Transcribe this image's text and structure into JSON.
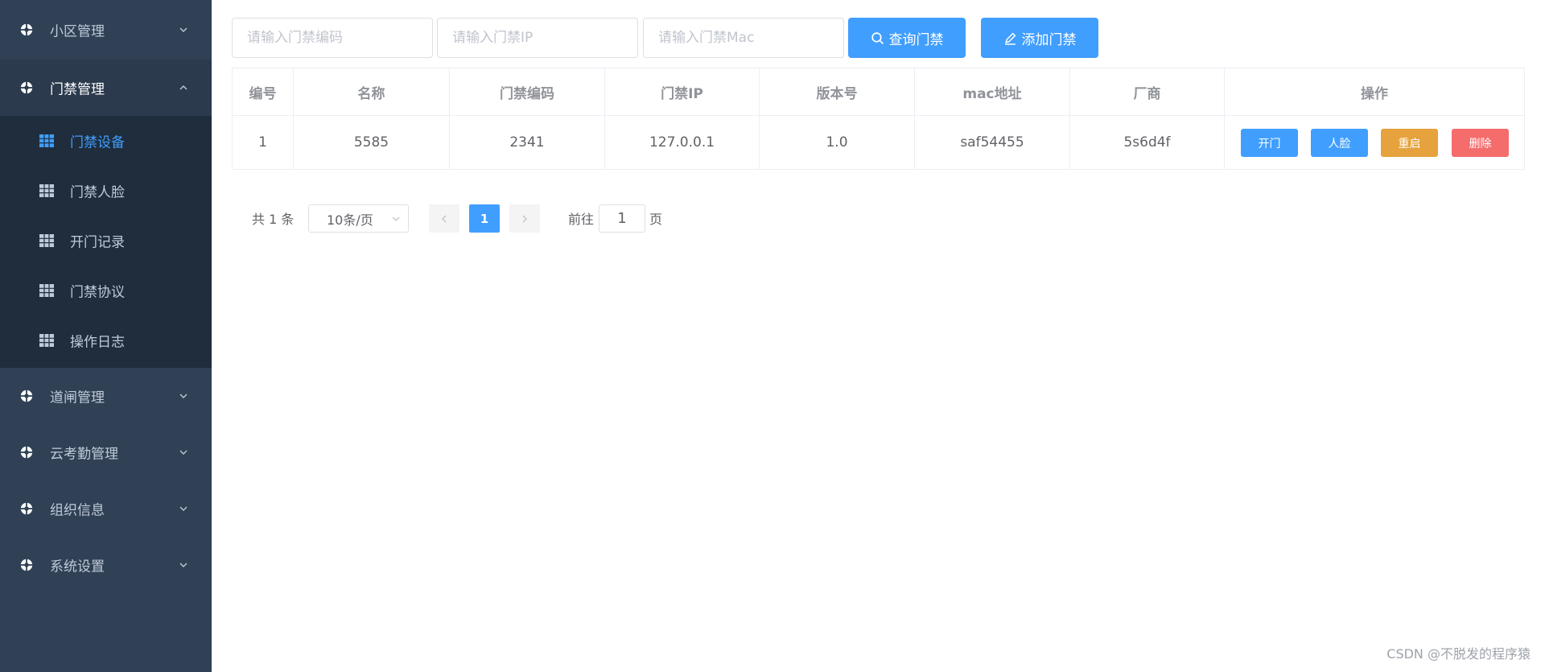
{
  "sidebar": {
    "groups_top": [
      {
        "label": "小区管理",
        "icon": "gear-icon"
      },
      {
        "label": "门禁管理",
        "icon": "gear-icon"
      }
    ],
    "submenu": [
      {
        "label": "门禁设备",
        "icon": "grid-icon",
        "active": true
      },
      {
        "label": "门禁人脸",
        "icon": "grid-icon"
      },
      {
        "label": "开门记录",
        "icon": "grid-icon"
      },
      {
        "label": "门禁协议",
        "icon": "grid-icon"
      },
      {
        "label": "操作日志",
        "icon": "grid-icon"
      }
    ],
    "groups_bottom": [
      {
        "label": "道闸管理",
        "icon": "gear-icon"
      },
      {
        "label": "云考勤管理",
        "icon": "gear-icon"
      },
      {
        "label": "组织信息",
        "icon": "gear-icon"
      },
      {
        "label": "系统设置",
        "icon": "gear-icon"
      }
    ]
  },
  "toolbar": {
    "code_placeholder": "请输入门禁编码",
    "ip_placeholder": "请输入门禁IP",
    "mac_placeholder": "请输入门禁Mac",
    "query_label": "查询门禁",
    "add_label": "添加门禁"
  },
  "table": {
    "headers": [
      "编号",
      "名称",
      "门禁编码",
      "门禁IP",
      "版本号",
      "mac地址",
      "厂商",
      "操作"
    ],
    "rows": [
      {
        "cells": [
          "1",
          "5585",
          "2341",
          "127.0.0.1",
          "1.0",
          "saf54455",
          "5s6d4f"
        ]
      }
    ],
    "actions": [
      {
        "label": "开门",
        "color": "#409eff"
      },
      {
        "label": "人脸",
        "color": "#409eff"
      },
      {
        "label": "重启",
        "color": "#e6a23c"
      },
      {
        "label": "删除",
        "color": "#f56c6c"
      }
    ]
  },
  "pagination": {
    "total_text": "共 1 条",
    "page_size": "10条/页",
    "current_page": "1",
    "goto_label": "前往",
    "jump_value": "1",
    "page_suffix": "页"
  },
  "watermark": "CSDN @不脱发的程序猿",
  "colors": {
    "sidebar_bg": "#304156",
    "submenu_bg": "#1f2d3d",
    "primary": "#409eff",
    "warning": "#e6a23c",
    "danger": "#f56c6c"
  }
}
